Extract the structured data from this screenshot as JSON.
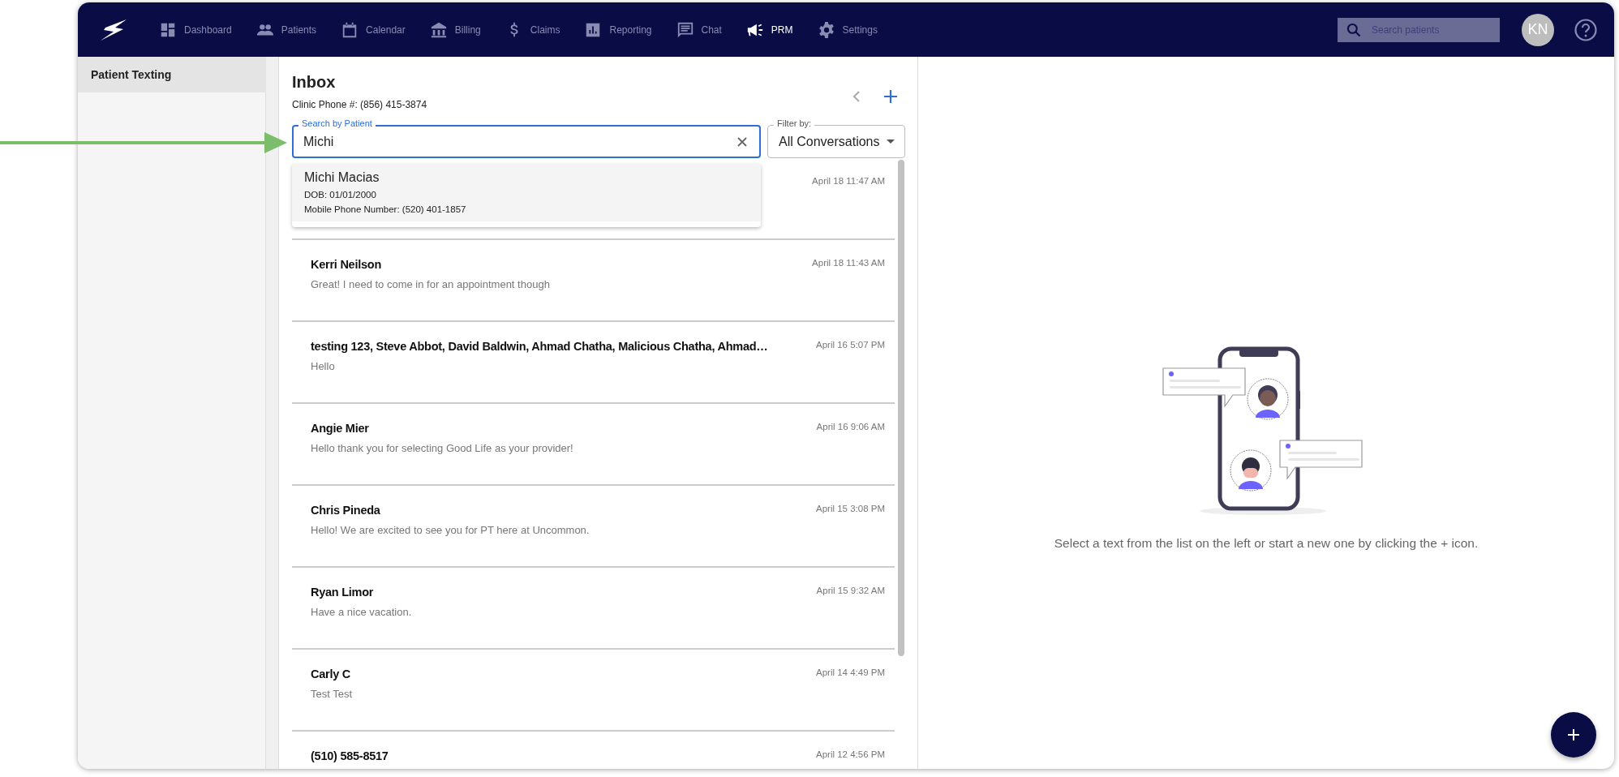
{
  "nav": {
    "items": [
      {
        "label": "Dashboard",
        "kind": "dashboard",
        "selected": false
      },
      {
        "label": "Patients",
        "kind": "people",
        "selected": false
      },
      {
        "label": "Calendar",
        "kind": "calendar",
        "selected": false
      },
      {
        "label": "Billing",
        "kind": "bank",
        "selected": false
      },
      {
        "label": "Claims",
        "kind": "dollar",
        "selected": false
      },
      {
        "label": "Reporting",
        "kind": "chart",
        "selected": false
      },
      {
        "label": "Chat",
        "kind": "chat",
        "selected": false
      },
      {
        "label": "PRM",
        "kind": "megaphone",
        "selected": true
      },
      {
        "label": "Settings",
        "kind": "gear",
        "selected": false
      }
    ],
    "search": {
      "placeholder": "Search patients"
    },
    "avatar": "KN"
  },
  "sidebar": {
    "items": [
      {
        "label": "Patient Texting",
        "selected": true
      }
    ]
  },
  "inbox": {
    "title": "Inbox",
    "clinic_phone": "Clinic Phone #: (856) 415-3874",
    "search": {
      "label": "Search by Patient",
      "value": "Michi"
    },
    "filter": {
      "label": "Filter by:",
      "value": "All Conversations"
    },
    "suggestions": [
      {
        "name": "Michi Macias",
        "dob": "DOB: 01/01/2000",
        "phone": "Mobile Phone Number: (520) 401-1857"
      }
    ],
    "conversations": [
      {
        "time": "April 18 11:47 AM"
      },
      {
        "name": "Kerri Neilson",
        "preview": "Great! I need to come in for an appointment though",
        "time": "April 18 11:43 AM"
      },
      {
        "name": "testing 123, Steve Abbot, David Baldwin, Ahmad Chatha, Malicious Chatha, Ahmad…",
        "preview": "Hello",
        "time": "April 16 5:07 PM"
      },
      {
        "name": "Angie Mier",
        "preview": "Hello thank you for selecting Good Life as your provider!",
        "time": "April 16 9:06 AM"
      },
      {
        "name": "Chris Pineda",
        "preview": "Hello! We are excited to see you for PT here at Uncommon.",
        "time": "April 15 3:08 PM"
      },
      {
        "name": "Ryan Limor",
        "preview": "Have a nice vacation.",
        "time": "April 15 9:32 AM"
      },
      {
        "name": "Carly C",
        "preview": "Test Test",
        "time": "April 14 4:49 PM"
      },
      {
        "name": "(510) 585-8517",
        "time": "April 12 4:56 PM"
      }
    ]
  },
  "detail": {
    "empty_message": "Select a text from the list on the left or start a new one by clicking the + icon."
  }
}
